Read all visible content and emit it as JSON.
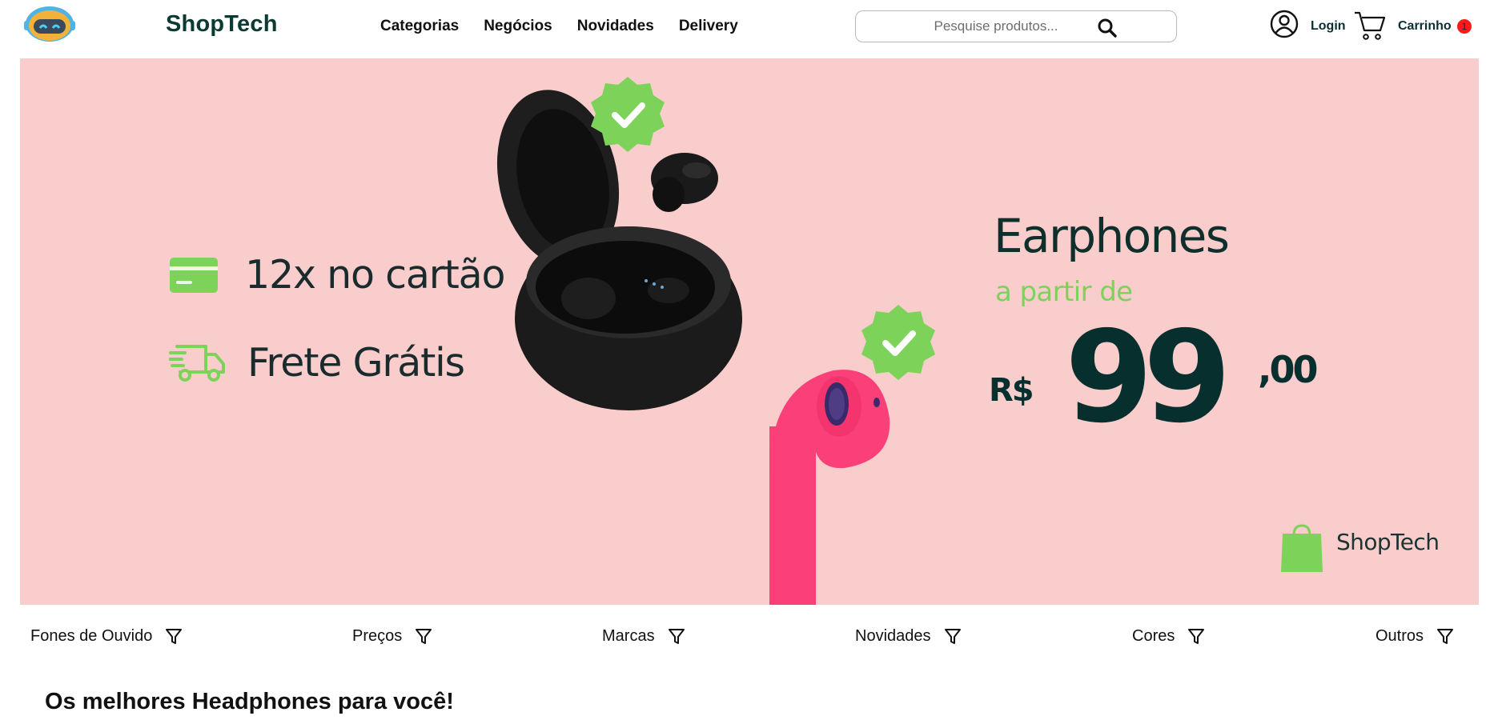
{
  "header": {
    "brand": "ShopTech",
    "nav": [
      "Categorias",
      "Negócios",
      "Novidades",
      "Delivery"
    ],
    "search_placeholder": "Pesquise produtos...",
    "login_label": "Login",
    "cart_label": "Carrinho",
    "cart_count": "1"
  },
  "banner": {
    "feature_installments": "12x no cartão",
    "feature_shipping": "Frete Grátis",
    "title": "Earphones",
    "subtitle": "a partir de",
    "currency": "R$",
    "price_int": "99",
    "price_cents": ",00",
    "brand": "ShopTech"
  },
  "filters": [
    "Fones de Ouvido",
    "Preços",
    "Marcas",
    "Novidades",
    "Cores",
    "Outros"
  ],
  "section_title": "Os melhores Headphones para você!",
  "colors": {
    "banner_bg": "#f9cdcc",
    "brand_dark": "#062f2d",
    "accent_green": "#7dd25a",
    "badge_red": "#ff1a1a",
    "earbud_pink": "#fa3f79"
  },
  "icons": [
    "mascot-logo",
    "search-icon",
    "user-icon",
    "cart-icon",
    "credit-card-icon",
    "truck-icon",
    "check-badge-icon",
    "shopping-bag-icon",
    "filter-icon"
  ]
}
